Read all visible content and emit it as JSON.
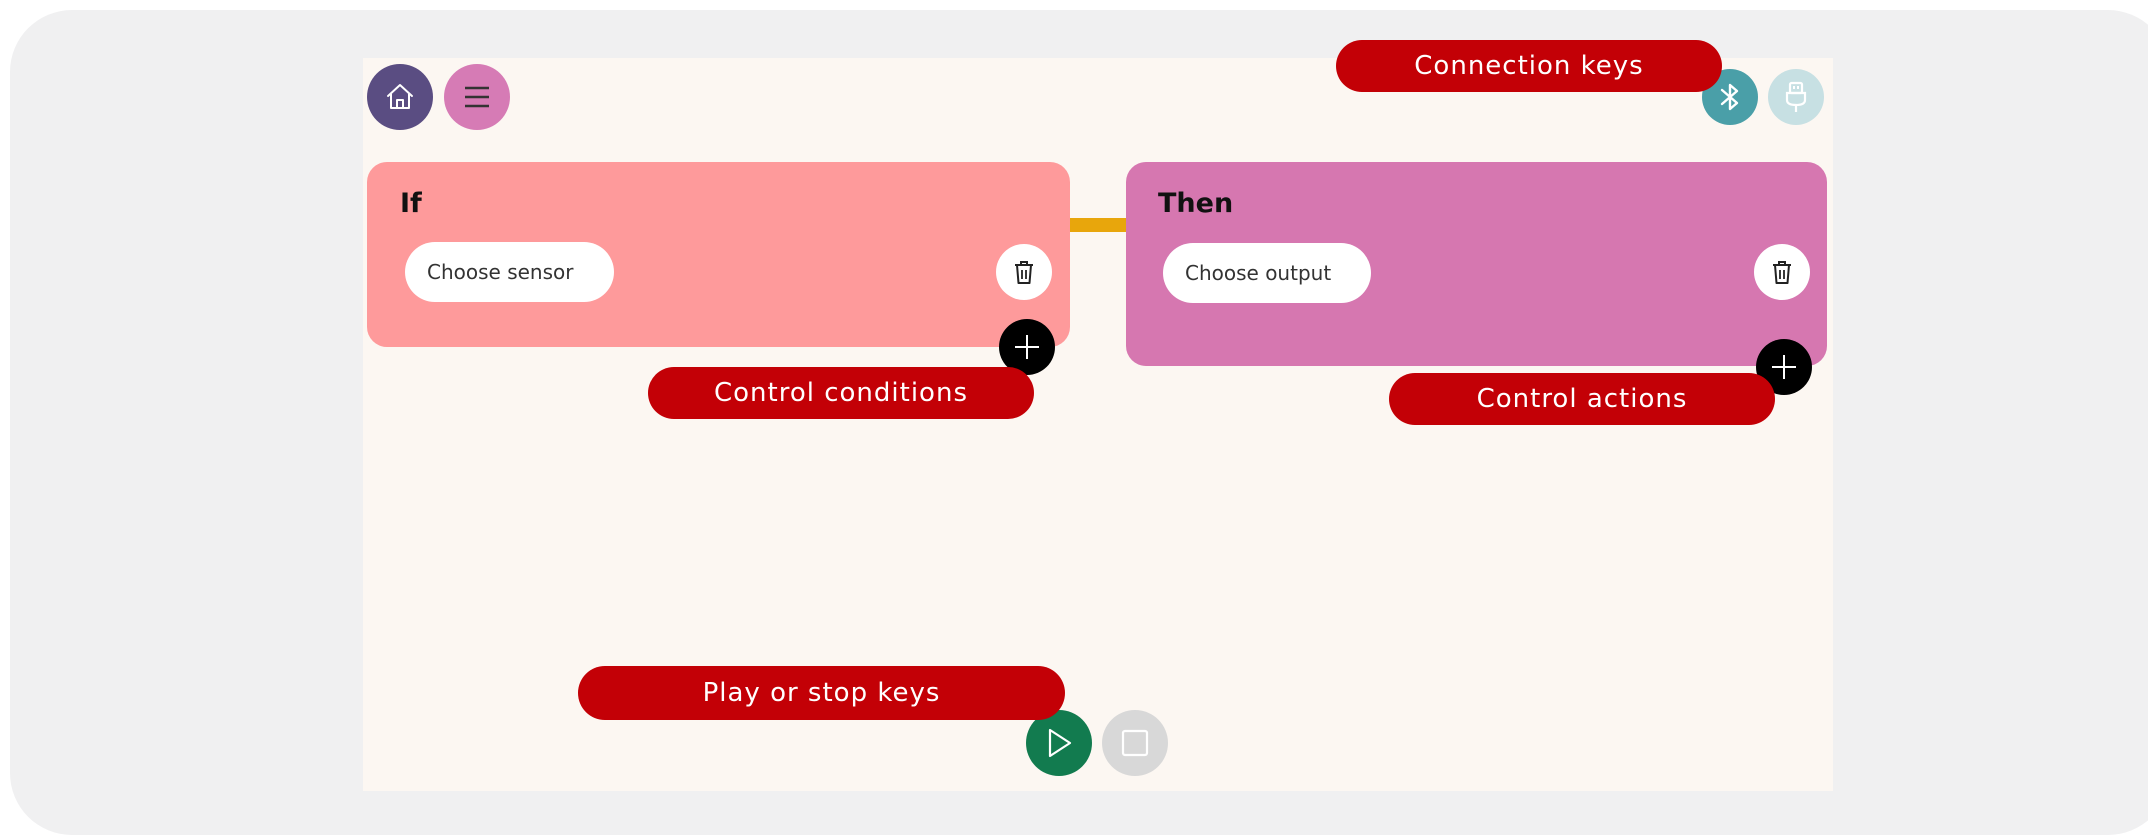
{
  "colors": {
    "home_button": "#5a4d82",
    "menu_button": "#d67bb5",
    "if_card": "#fe9a9b",
    "then_card": "#d677b0",
    "connector": "#e8a60c",
    "bluetooth": "#4a9fa8",
    "usb": "#c7e0e3",
    "play": "#127b4f",
    "stop": "#d8d8d8",
    "callout": "#c30006"
  },
  "if_block": {
    "title": "If",
    "sensor_placeholder": "Choose sensor"
  },
  "then_block": {
    "title": "Then",
    "output_placeholder": "Choose output"
  },
  "callouts": {
    "connection_keys": "Connection keys",
    "control_conditions": "Control conditions",
    "control_actions": "Control actions",
    "play_stop_keys": "Play or stop keys"
  },
  "icons": {
    "home": "home-icon",
    "menu": "hamburger-menu-icon",
    "bluetooth": "bluetooth-icon",
    "usb": "usb-plug-icon",
    "trash": "trash-icon",
    "plus": "plus-icon",
    "play": "play-icon",
    "stop": "stop-icon"
  }
}
